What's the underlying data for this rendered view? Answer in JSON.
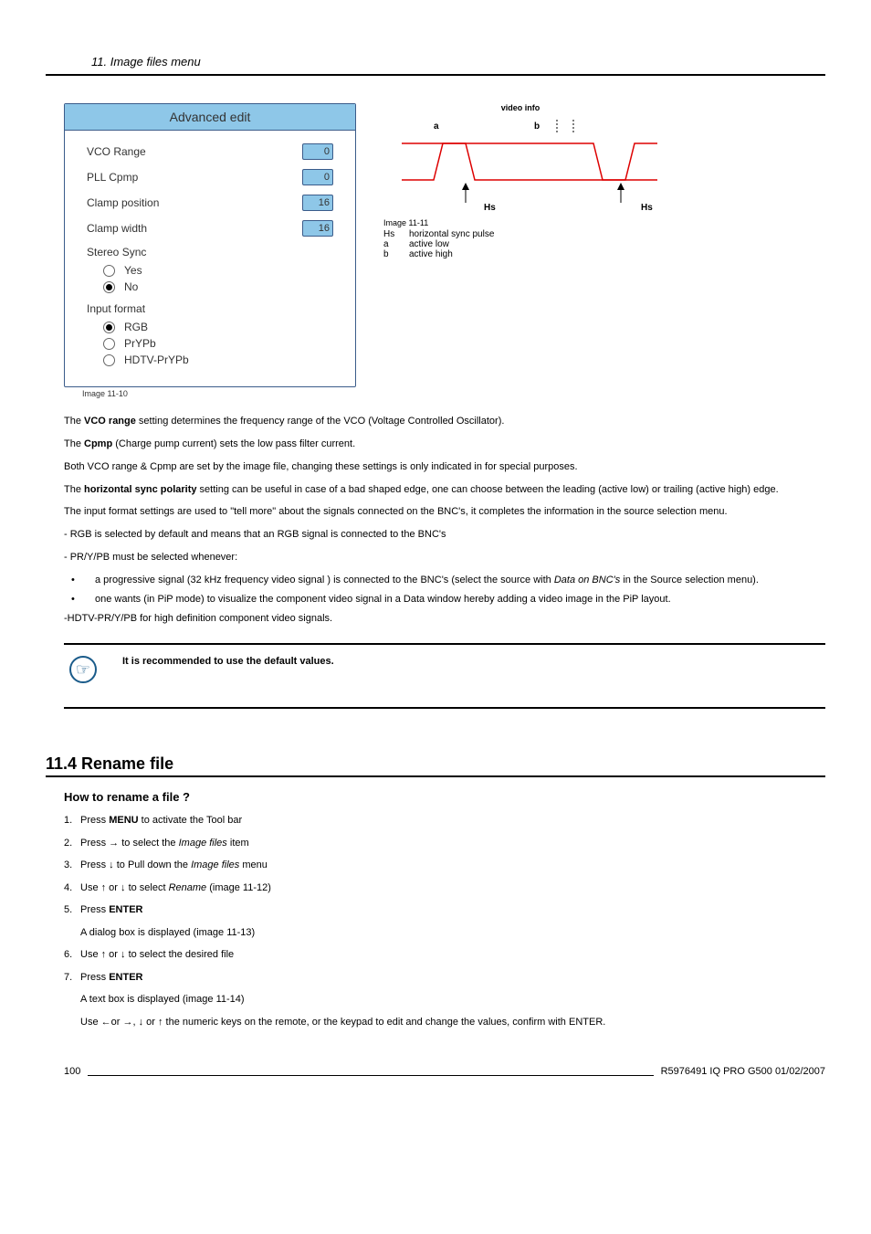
{
  "header": {
    "section_title": "11.  Image files menu"
  },
  "panel": {
    "title": "Advanced edit",
    "fields": [
      {
        "label": "VCO Range",
        "value": "0"
      },
      {
        "label": "PLL Cpmp",
        "value": "0"
      },
      {
        "label": "Clamp position",
        "value": "16"
      },
      {
        "label": "Clamp width",
        "value": "16"
      }
    ],
    "stereo_label": "Stereo Sync",
    "stereo_yes": "Yes",
    "stereo_no": "No",
    "input_label": "Input format",
    "input_rgb": "RGB",
    "input_prypb": "PrYPb",
    "input_hdtv": "HDTV-PrYPb",
    "caption": "Image 11-10"
  },
  "diagram": {
    "title": "video info",
    "label_a": "a",
    "label_b": "b",
    "label_hs_left": "Hs",
    "label_hs_right": "Hs",
    "caption": "Image 11-11",
    "legend": [
      {
        "k": "Hs",
        "v": "horizontal sync pulse"
      },
      {
        "k": "a",
        "v": "active low"
      },
      {
        "k": "b",
        "v": "active high"
      }
    ]
  },
  "paragraphs": {
    "p1a": "The ",
    "p1b": "VCO range",
    "p1c": " setting determines the frequency range of the VCO (Voltage Controlled Oscillator).",
    "p2a": "The ",
    "p2b": "Cpmp",
    "p2c": " (Charge pump current) sets the low pass filter current.",
    "p3": "Both VCO range & Cpmp are set by the image file, changing these settings is only indicated in for special purposes.",
    "p4a": "The ",
    "p4b": "horizontal sync polarity",
    "p4c": " setting can be useful in case of a bad shaped edge, one can choose between the leading (active low) or trailing (active high) edge.",
    "p5": "The input format settings are used to \"tell more\" about the signals connected on the BNC's, it completes the information in the source selection menu.",
    "p6": "- RGB is selected by default and means that an RGB signal is connected to the BNC's",
    "p7": "- PR/Y/PB must be selected whenever:",
    "b1a": "a progressive signal (32 kHz frequency video signal ) is connected to the BNC's (select the source with ",
    "b1b": "Data on BNC's",
    "b1c": " in the Source selection menu).",
    "b2": "one wants (in PiP mode) to visualize the component video signal in a Data window hereby adding a video image in the PiP layout.",
    "p8": "-HDTV-PR/Y/PB for high definition component video signals."
  },
  "note": {
    "text": "It is recommended to use the default values."
  },
  "section": {
    "heading": "11.4  Rename file",
    "sub": "How to rename a file ?",
    "steps": [
      {
        "n": "1.",
        "parts": [
          "Press ",
          "MENU",
          " to activate the Tool bar"
        ]
      },
      {
        "n": "2.",
        "parts": [
          "Press → to select the ",
          "Image files",
          " item"
        ]
      },
      {
        "n": "3.",
        "parts": [
          "Press ↓ to Pull down the ",
          "Image files",
          " menu"
        ]
      },
      {
        "n": "4.",
        "parts": [
          "Use ↑ or ↓ to select ",
          "Rename",
          " (image 11-12)"
        ]
      },
      {
        "n": "5.",
        "parts": [
          "Press ",
          "ENTER",
          ""
        ]
      },
      {
        "n": "6.",
        "parts": [
          "Use ↑ or ↓ to select the desired file",
          "",
          ""
        ]
      },
      {
        "n": "7.",
        "parts": [
          "Press ",
          "ENTER",
          ""
        ]
      }
    ],
    "step5_sub": "A dialog box is displayed (image 11-13)",
    "step7_sub1": "A text box is displayed (image 11-14)",
    "step7_sub2": "Use ←or →, ↓ or ↑ the numeric keys on the remote, or the keypad to edit and change the values, confirm with ENTER."
  },
  "footer": {
    "page": "100",
    "doc": "R5976491  IQ PRO G500  01/02/2007"
  }
}
